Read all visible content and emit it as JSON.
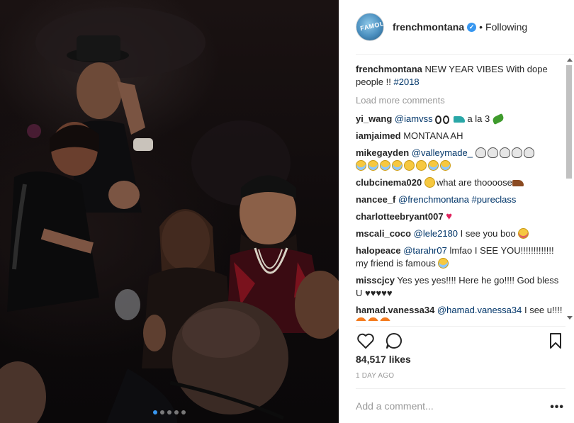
{
  "post": {
    "author": "frenchmontana",
    "follow_status": "Following",
    "separator": "•",
    "avatar_text": "FAMOUS",
    "caption": {
      "user": "frenchmontana",
      "text": "NEW YEAR VIBES With dope people !! ",
      "hashtag": "#2018"
    },
    "load_more": "Load more comments",
    "comments": [
      {
        "user": "yi_wang",
        "mention": "@iamvss",
        "text": " a la 3 "
      },
      {
        "user": "iamjaimed",
        "text": "MONTANA AH"
      },
      {
        "user": "mikegayden",
        "mention": "@valleymade_",
        "text": ""
      },
      {
        "user": "clubcinema020",
        "text": "what are thoooose"
      },
      {
        "user": "nancee_f",
        "mention": "@frenchmontana",
        "hashtag": "#pureclass"
      },
      {
        "user": "charlotteebryant007",
        "text": ""
      },
      {
        "user": "mscali_coco",
        "mention": "@lele2180",
        "text": " I see you boo "
      },
      {
        "user": "halopeace",
        "mention": "@tarahr07",
        "text": " lmfao I SEE YOU!!!!!!!!!!!!! my friend is famous "
      },
      {
        "user": "misscjcy",
        "text": "Yes yes yes!!!! Here he go!!!! God bless U ♥♥♥♥♥"
      },
      {
        "user": "hamad.vanessa34",
        "mention": "@hamad.vanessa34",
        "text": " I see u!!!!"
      }
    ],
    "likes": "84,517 likes",
    "time": "1 DAY AGO",
    "add_comment_placeholder": "Add a comment...",
    "more_options": "•••"
  },
  "carousel": {
    "count": 5,
    "active": 0
  },
  "colors": {
    "accent": "#3897f0",
    "link": "#003569",
    "muted": "#999999"
  },
  "icons": [
    "heart-icon",
    "comment-icon",
    "bookmark-icon",
    "verified-badge-icon",
    "more-options-icon"
  ]
}
